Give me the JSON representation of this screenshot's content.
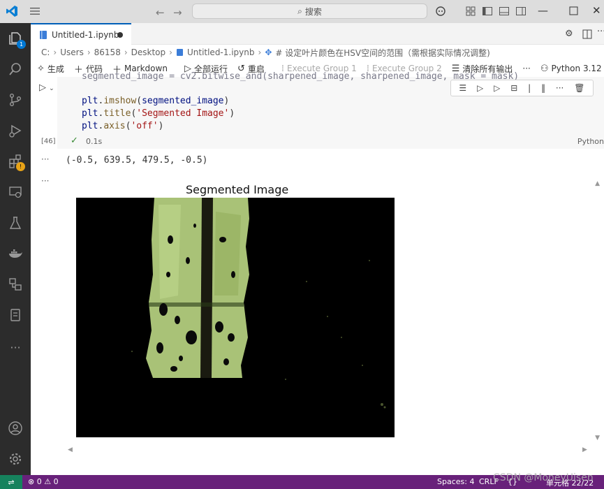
{
  "titlebar": {
    "search_label": "搜索"
  },
  "activity": {
    "explorer_badge": "1"
  },
  "tab": {
    "label": "Untitled-1.ipynb"
  },
  "breadcrumb": {
    "items": [
      "C:",
      "Users",
      "86158",
      "Desktop",
      "Untitled-1.ipynb",
      "# 设定叶片颜色在HSV空间的范围（需根据实际情况调整)"
    ]
  },
  "toolbar": {
    "generate": "生成",
    "code": "代码",
    "markdown": "Markdown",
    "run_all": "全部运行",
    "restart": "重启",
    "exec_group_1": "Execute Group 1",
    "exec_group_2": "Execute Group 2",
    "clear_outputs": "清除所有输出",
    "more": "···",
    "kernel": "Python 3.12"
  },
  "cell": {
    "code_lines": [
      "segmented_image = cv2.bitwise_and(sharpened_image, sharpened_image, mask = mask)",
      "",
      "plt.imshow(segmented_image)",
      "plt.title('Segmented Image')",
      "plt.axis('off')"
    ],
    "exec_count": "[46]",
    "duration": "0.1s",
    "language": "Python"
  },
  "output": {
    "ellipsis": "···",
    "axis_result": "(-0.5, 639.5, 479.5, -0.5)",
    "plot_title": "Segmented Image"
  },
  "statusbar": {
    "errors": "0",
    "warnings": "0",
    "spaces": "Spaces: 4",
    "eol": "CRLF",
    "braces": "{}",
    "cell_position": "单元格 22/22"
  },
  "watermark": "CSDN @MoneyUisen",
  "colors": {
    "accent": "#005fb8",
    "statusbar": "#68217a",
    "activitybar": "#2c2c2c"
  }
}
